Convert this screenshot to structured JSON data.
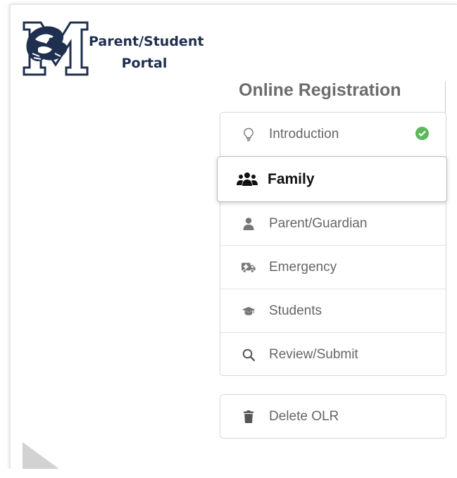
{
  "portal": {
    "title_line1": "Parent/Student",
    "title_line2": "Portal",
    "logo_icon": "m-wildcat-logo",
    "brand_color": "#1f2f4f"
  },
  "registration": {
    "title": "Online Registration",
    "steps": [
      {
        "label": "Introduction",
        "icon": "lightbulb-icon",
        "completed": true
      },
      {
        "label": "Family",
        "icon": "users-icon",
        "active": true
      },
      {
        "label": "Parent/Guardian",
        "icon": "user-icon"
      },
      {
        "label": "Emergency",
        "icon": "ambulance-icon"
      },
      {
        "label": "Students",
        "icon": "graduation-cap-icon"
      },
      {
        "label": "Review/Submit",
        "icon": "search-icon"
      }
    ],
    "delete_label": "Delete OLR",
    "delete_icon": "trash-icon",
    "completed_color": "#5cb85c",
    "muted_text_color": "#666666"
  }
}
